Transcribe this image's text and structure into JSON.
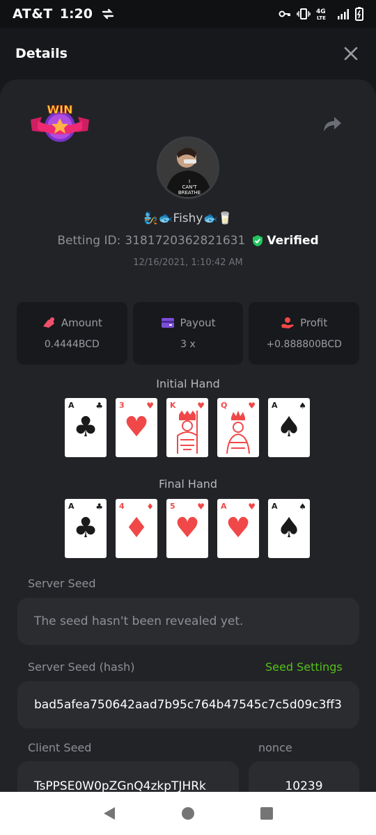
{
  "status_bar": {
    "carrier": "AT&T",
    "time": "1:20"
  },
  "header": {
    "title": "Details"
  },
  "bet": {
    "username": "🧞🐟Fishy🐟🥛",
    "betting_id_label": "Betting ID:",
    "betting_id": "3181720362821631",
    "verified_label": "Verified",
    "timestamp": "12/16/2021, 1:10:42 AM"
  },
  "stats": [
    {
      "label": "Amount",
      "value": "0.4444BCD",
      "icon": "amount-icon",
      "color": "#f0506e"
    },
    {
      "label": "Payout",
      "value": "3 x",
      "icon": "payout-icon",
      "color": "#7c4ddb"
    },
    {
      "label": "Profit",
      "value": "+0.888800BCD",
      "icon": "profit-icon",
      "color": "#f04848"
    }
  ],
  "initial_hand": {
    "title": "Initial Hand",
    "cards": [
      {
        "rank": "A",
        "suit": "♣",
        "color": "black"
      },
      {
        "rank": "3",
        "suit": "♥",
        "color": "red"
      },
      {
        "rank": "K",
        "suit": "♥",
        "color": "red"
      },
      {
        "rank": "Q",
        "suit": "♥",
        "color": "red"
      },
      {
        "rank": "A",
        "suit": "♠",
        "color": "black"
      }
    ]
  },
  "final_hand": {
    "title": "Final Hand",
    "cards": [
      {
        "rank": "A",
        "suit": "♣",
        "color": "black"
      },
      {
        "rank": "4",
        "suit": "♦",
        "color": "red"
      },
      {
        "rank": "5",
        "suit": "♥",
        "color": "red"
      },
      {
        "rank": "A",
        "suit": "♥",
        "color": "red"
      },
      {
        "rank": "A",
        "suit": "♠",
        "color": "black"
      }
    ]
  },
  "seeds": {
    "server_seed_label": "Server Seed",
    "server_seed_value": "The seed hasn't been revealed yet.",
    "server_hash_label": "Server Seed (hash)",
    "seed_settings_label": "Seed Settings",
    "server_hash_value": "bad5afea750642aad7b95c764b47545c7c5d09c3ff3",
    "client_seed_label": "Client Seed",
    "client_seed_value": "TsPPSE0W0pZGnQ4zkpTJHRk",
    "nonce_label": "nonce",
    "nonce_value": "10239"
  },
  "colors": {
    "accent_green": "#55c11a",
    "card_bg": "#222326",
    "verified_green": "#22c55e"
  }
}
